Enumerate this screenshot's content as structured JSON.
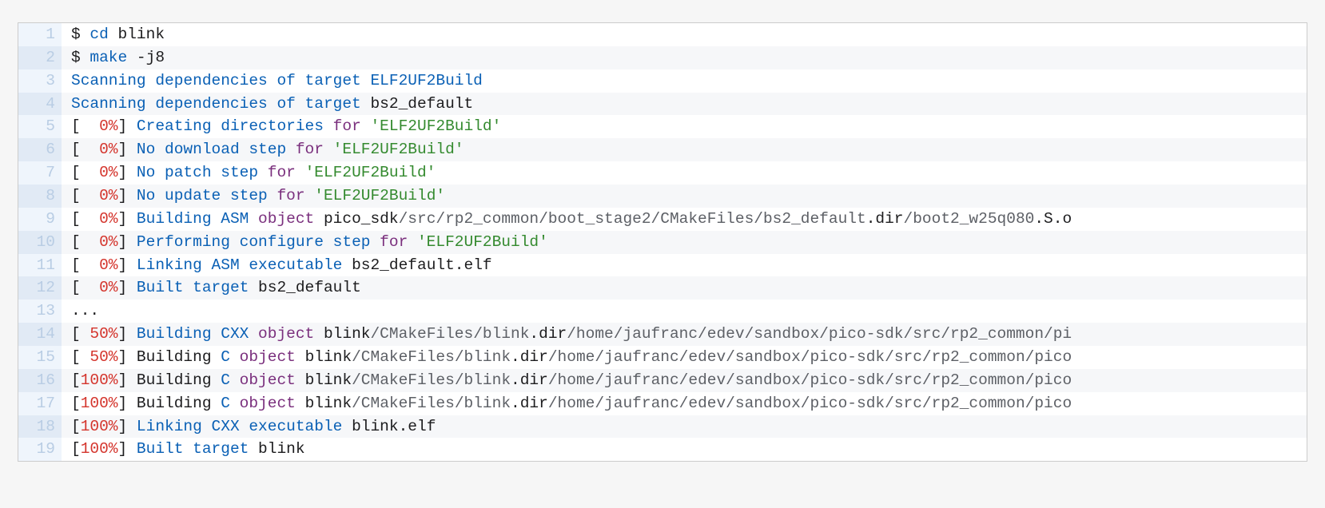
{
  "code": {
    "lines": [
      {
        "n": 1,
        "tokens": [
          {
            "c": "default",
            "t": "$ "
          },
          {
            "c": "cmd",
            "t": "cd"
          },
          {
            "c": "default",
            "t": " blink"
          }
        ]
      },
      {
        "n": 2,
        "tokens": [
          {
            "c": "default",
            "t": "$ "
          },
          {
            "c": "cmd",
            "t": "make"
          },
          {
            "c": "default",
            "t": " -j8"
          }
        ]
      },
      {
        "n": 3,
        "tokens": [
          {
            "c": "blue",
            "t": "Scanning dependencies of target ELF2UF2Build"
          }
        ]
      },
      {
        "n": 4,
        "tokens": [
          {
            "c": "blue",
            "t": "Scanning dependencies of target "
          },
          {
            "c": "default",
            "t": "bs2_default"
          }
        ]
      },
      {
        "n": 5,
        "tokens": [
          {
            "c": "default",
            "t": "[  "
          },
          {
            "c": "red",
            "t": "0%"
          },
          {
            "c": "default",
            "t": "] "
          },
          {
            "c": "blue",
            "t": "Creating directories "
          },
          {
            "c": "kw",
            "t": "for"
          },
          {
            "c": "blue",
            "t": " "
          },
          {
            "c": "string",
            "t": "'ELF2UF2Build'"
          }
        ]
      },
      {
        "n": 6,
        "tokens": [
          {
            "c": "default",
            "t": "[  "
          },
          {
            "c": "red",
            "t": "0%"
          },
          {
            "c": "default",
            "t": "] "
          },
          {
            "c": "blue",
            "t": "No download step "
          },
          {
            "c": "kw",
            "t": "for"
          },
          {
            "c": "blue",
            "t": " "
          },
          {
            "c": "string",
            "t": "'ELF2UF2Build'"
          }
        ]
      },
      {
        "n": 7,
        "tokens": [
          {
            "c": "default",
            "t": "[  "
          },
          {
            "c": "red",
            "t": "0%"
          },
          {
            "c": "default",
            "t": "] "
          },
          {
            "c": "blue",
            "t": "No patch step "
          },
          {
            "c": "kw",
            "t": "for"
          },
          {
            "c": "blue",
            "t": " "
          },
          {
            "c": "string",
            "t": "'ELF2UF2Build'"
          }
        ]
      },
      {
        "n": 8,
        "tokens": [
          {
            "c": "default",
            "t": "[  "
          },
          {
            "c": "red",
            "t": "0%"
          },
          {
            "c": "default",
            "t": "] "
          },
          {
            "c": "blue",
            "t": "No update step "
          },
          {
            "c": "kw",
            "t": "for"
          },
          {
            "c": "blue",
            "t": " "
          },
          {
            "c": "string",
            "t": "'ELF2UF2Build'"
          }
        ]
      },
      {
        "n": 9,
        "tokens": [
          {
            "c": "default",
            "t": "[  "
          },
          {
            "c": "red",
            "t": "0%"
          },
          {
            "c": "default",
            "t": "] "
          },
          {
            "c": "blue",
            "t": "Building ASM "
          },
          {
            "c": "kw",
            "t": "object"
          },
          {
            "c": "default",
            "t": " pico_sdk"
          },
          {
            "c": "path",
            "t": "/src/rp2_common/boot_stage2/CMakeFiles/bs2_default"
          },
          {
            "c": "default",
            "t": ".dir"
          },
          {
            "c": "path",
            "t": "/boot2_w25q080"
          },
          {
            "c": "default",
            "t": ".S.o"
          }
        ]
      },
      {
        "n": 10,
        "tokens": [
          {
            "c": "default",
            "t": "[  "
          },
          {
            "c": "red",
            "t": "0%"
          },
          {
            "c": "default",
            "t": "] "
          },
          {
            "c": "blue",
            "t": "Performing configure step "
          },
          {
            "c": "kw",
            "t": "for"
          },
          {
            "c": "blue",
            "t": " "
          },
          {
            "c": "string",
            "t": "'ELF2UF2Build'"
          }
        ]
      },
      {
        "n": 11,
        "tokens": [
          {
            "c": "default",
            "t": "[  "
          },
          {
            "c": "red",
            "t": "0%"
          },
          {
            "c": "default",
            "t": "] "
          },
          {
            "c": "blue",
            "t": "Linking ASM executable "
          },
          {
            "c": "default",
            "t": "bs2_default.elf"
          }
        ]
      },
      {
        "n": 12,
        "tokens": [
          {
            "c": "default",
            "t": "[  "
          },
          {
            "c": "red",
            "t": "0%"
          },
          {
            "c": "default",
            "t": "] "
          },
          {
            "c": "blue",
            "t": "Built target "
          },
          {
            "c": "default",
            "t": "bs2_default"
          }
        ]
      },
      {
        "n": 13,
        "tokens": [
          {
            "c": "default",
            "t": "..."
          }
        ]
      },
      {
        "n": 14,
        "tokens": [
          {
            "c": "default",
            "t": "[ "
          },
          {
            "c": "red",
            "t": "50%"
          },
          {
            "c": "default",
            "t": "] "
          },
          {
            "c": "blue",
            "t": "Building CXX "
          },
          {
            "c": "kw",
            "t": "object"
          },
          {
            "c": "default",
            "t": " blink"
          },
          {
            "c": "path",
            "t": "/CMakeFiles/blink"
          },
          {
            "c": "default",
            "t": ".dir"
          },
          {
            "c": "path",
            "t": "/home/jaufranc/edev/sandbox/pico-sdk/src/rp2_common/pi"
          }
        ]
      },
      {
        "n": 15,
        "tokens": [
          {
            "c": "default",
            "t": "[ "
          },
          {
            "c": "red",
            "t": "50%"
          },
          {
            "c": "default",
            "t": "] Building "
          },
          {
            "c": "blue",
            "t": "C"
          },
          {
            "c": "default",
            "t": " "
          },
          {
            "c": "kw",
            "t": "object"
          },
          {
            "c": "default",
            "t": " blink"
          },
          {
            "c": "path",
            "t": "/CMakeFiles/blink"
          },
          {
            "c": "default",
            "t": ".dir"
          },
          {
            "c": "path",
            "t": "/home/jaufranc/edev/sandbox/pico-sdk/src/rp2_common/pico"
          }
        ]
      },
      {
        "n": 16,
        "tokens": [
          {
            "c": "default",
            "t": "["
          },
          {
            "c": "red",
            "t": "100%"
          },
          {
            "c": "default",
            "t": "] Building "
          },
          {
            "c": "blue",
            "t": "C"
          },
          {
            "c": "default",
            "t": " "
          },
          {
            "c": "kw",
            "t": "object"
          },
          {
            "c": "default",
            "t": " blink"
          },
          {
            "c": "path",
            "t": "/CMakeFiles/blink"
          },
          {
            "c": "default",
            "t": ".dir"
          },
          {
            "c": "path",
            "t": "/home/jaufranc/edev/sandbox/pico-sdk/src/rp2_common/pico"
          }
        ]
      },
      {
        "n": 17,
        "tokens": [
          {
            "c": "default",
            "t": "["
          },
          {
            "c": "red",
            "t": "100%"
          },
          {
            "c": "default",
            "t": "] Building "
          },
          {
            "c": "blue",
            "t": "C"
          },
          {
            "c": "default",
            "t": " "
          },
          {
            "c": "kw",
            "t": "object"
          },
          {
            "c": "default",
            "t": " blink"
          },
          {
            "c": "path",
            "t": "/CMakeFiles/blink"
          },
          {
            "c": "default",
            "t": ".dir"
          },
          {
            "c": "path",
            "t": "/home/jaufranc/edev/sandbox/pico-sdk/src/rp2_common/pico"
          }
        ]
      },
      {
        "n": 18,
        "tokens": [
          {
            "c": "default",
            "t": "["
          },
          {
            "c": "red",
            "t": "100%"
          },
          {
            "c": "default",
            "t": "] "
          },
          {
            "c": "blue",
            "t": "Linking CXX executable "
          },
          {
            "c": "default",
            "t": "blink.elf"
          }
        ]
      },
      {
        "n": 19,
        "tokens": [
          {
            "c": "default",
            "t": "["
          },
          {
            "c": "red",
            "t": "100%"
          },
          {
            "c": "default",
            "t": "] "
          },
          {
            "c": "blue",
            "t": "Built target "
          },
          {
            "c": "default",
            "t": "blink"
          }
        ]
      }
    ]
  }
}
